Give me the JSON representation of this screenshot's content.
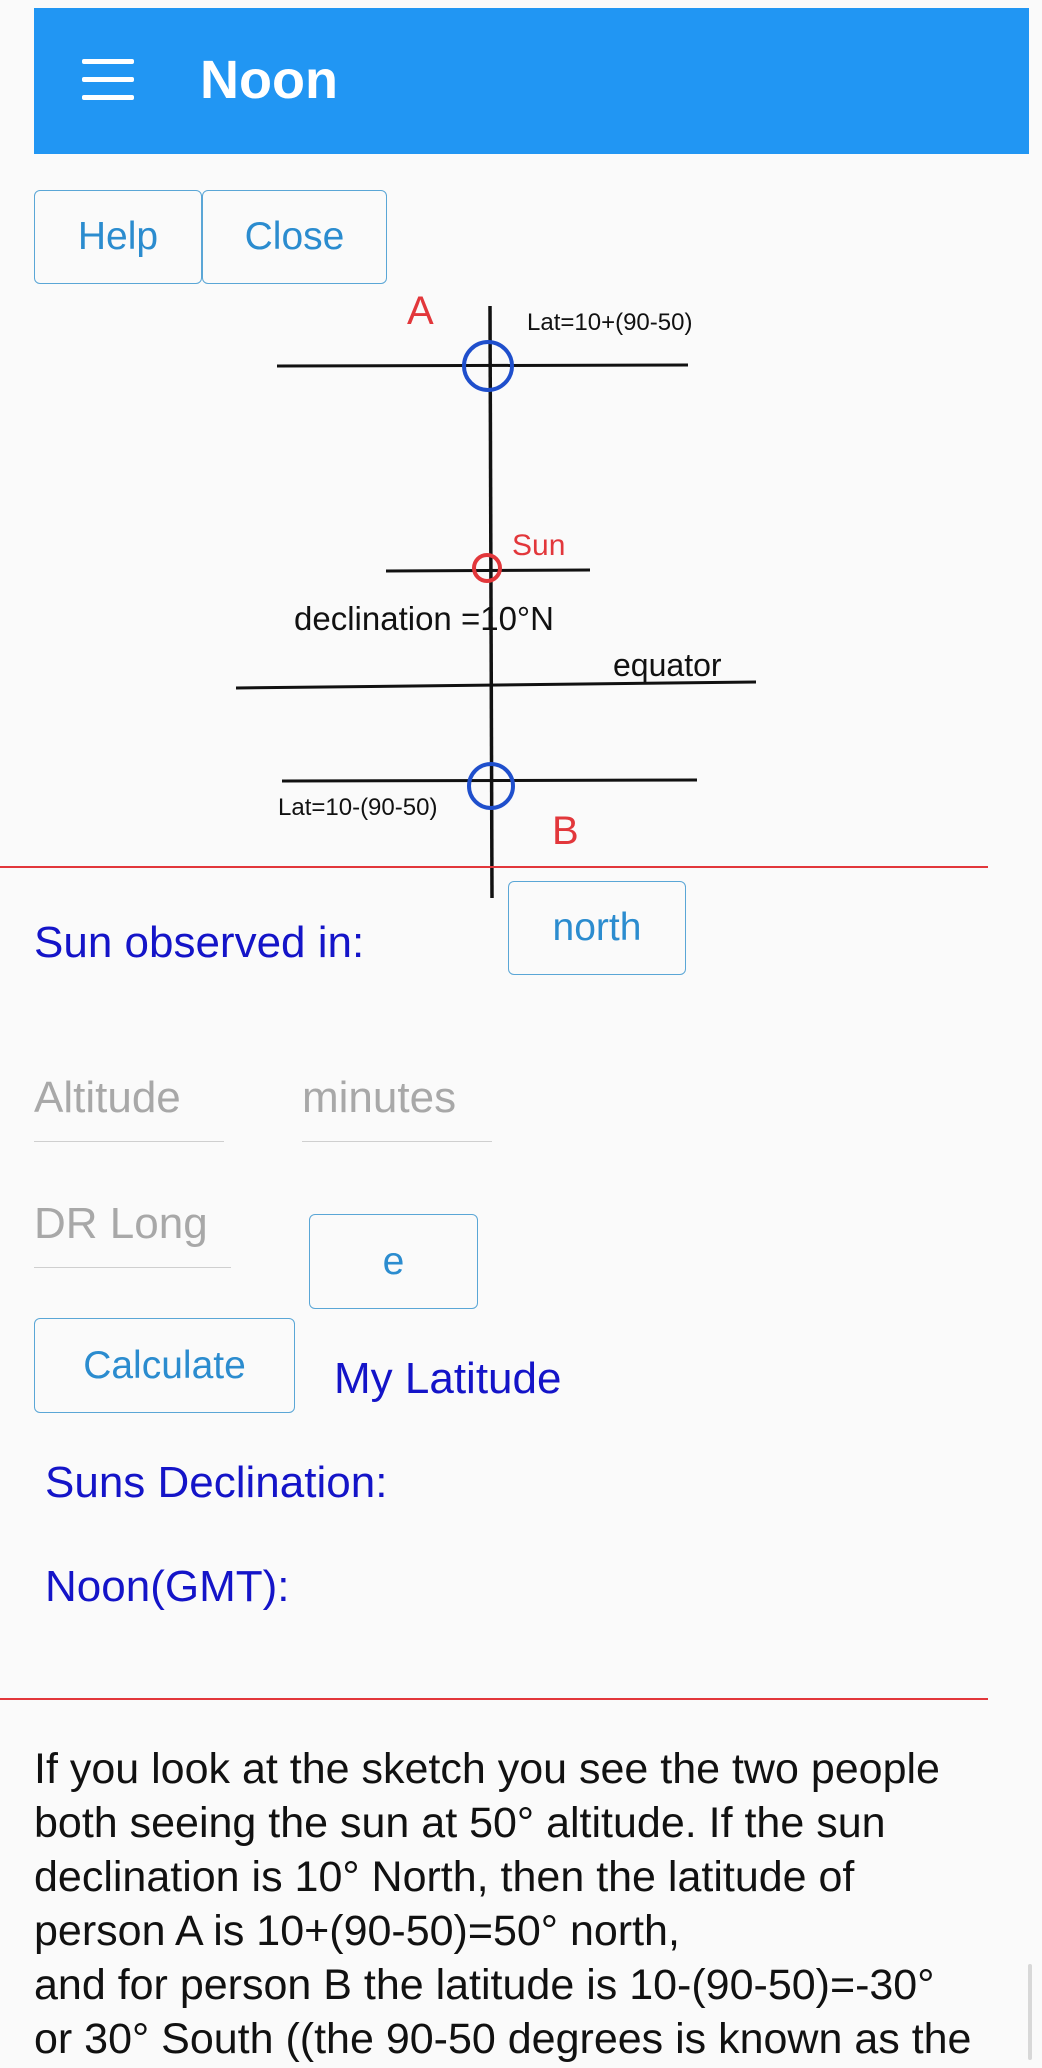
{
  "appbar": {
    "title": "Noon",
    "menu_icon": "hamburger-menu-icon",
    "color": "#2196f3"
  },
  "buttons": {
    "help": "Help",
    "close": "Close",
    "direction": "north",
    "hemisphere": "e",
    "calculate": "Calculate"
  },
  "diagram": {
    "label_a": "A",
    "label_b": "B",
    "lat_a": "Lat=10+(90-50)",
    "lat_b": "Lat=10-(90-50)",
    "sun": "Sun",
    "declination": "declination =10°N",
    "equator": "equator",
    "colors": {
      "red": "#e2373b",
      "blue": "#1f4fcc",
      "line": "#111111"
    }
  },
  "form": {
    "sun_observed_label": "Sun observed in:",
    "altitude_placeholder": "Altitude",
    "minutes_placeholder": "minutes",
    "dr_long_placeholder": "DR Long",
    "my_latitude": "My Latitude",
    "suns_declination": "Suns Declination:",
    "noon_gmt": "Noon(GMT):"
  },
  "help_text": {
    "line1": "If you look at the sketch you see the two people",
    "line2": "both seeing the sun at 50° altitude. If the sun",
    "line3": "declination is 10° North, then the latitude of",
    "line4": "person A is 10+(90-50)=50° north,",
    "line5": "and for person B the latitude is 10-(90-50)=-30°",
    "line6": "or 30° South ((the 90-50 degrees is known as the"
  },
  "colors": {
    "accent": "#2196f3",
    "button_text": "#2b8ccf",
    "label_blue": "#1414c8",
    "divider_red": "#e2373b"
  }
}
